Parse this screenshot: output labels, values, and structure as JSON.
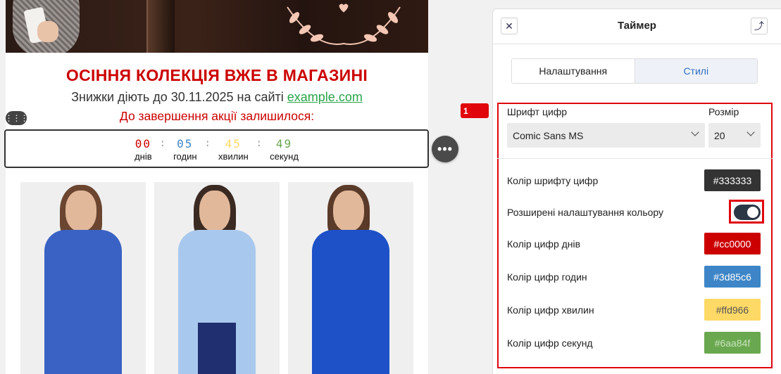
{
  "email": {
    "title": "ОСІННЯ КОЛЕКЦІЯ ВЖЕ В МАГАЗИНІ",
    "subtitle_prefix": "Знижки діють до 30.11.2025 на сайті ",
    "subtitle_link": "example.com",
    "until_text": "До завершення акції залишилося:",
    "timer": {
      "days": {
        "value": "00",
        "label": "днів",
        "color": "#cc0000"
      },
      "hours": {
        "value": "05",
        "label": "годин",
        "color": "#3d85c6"
      },
      "minutes": {
        "value": "45",
        "label": "хвилин",
        "color": "#ffd966"
      },
      "seconds": {
        "value": "49",
        "label": "секунд",
        "color": "#6aa84f"
      },
      "separator": ":"
    },
    "products": [
      {
        "coat_color": "#3a62c4"
      },
      {
        "coat_color": "#a9c8ee"
      },
      {
        "coat_color": "#1e50c8"
      }
    ]
  },
  "panel": {
    "title": "Таймер",
    "close_icon": "close-icon",
    "collapse_icon": "arrow-up-icon",
    "tabs": [
      {
        "label": "Налаштування",
        "active": false
      },
      {
        "label": "Стилі",
        "active": true
      }
    ],
    "badge": "1",
    "font_label": "Шрифт цифр",
    "font_value": "Comic Sans MS",
    "size_label": "Розмір",
    "size_value": "20",
    "rows": {
      "font_color": {
        "label": "Колір шрифту цифр",
        "value": "#333333"
      },
      "advanced": {
        "label": "Розширені налаштування кольору",
        "enabled": true
      },
      "days_color": {
        "label": "Колір цифр днів",
        "value": "#cc0000"
      },
      "hours_color": {
        "label": "Колір цифр годин",
        "value": "#3d85c6"
      },
      "minutes_color": {
        "label": "Колір цифр хвилин",
        "value": "#ffd966"
      },
      "seconds_color": {
        "label": "Колір цифр секунд",
        "value": "#6aa84f"
      }
    }
  }
}
